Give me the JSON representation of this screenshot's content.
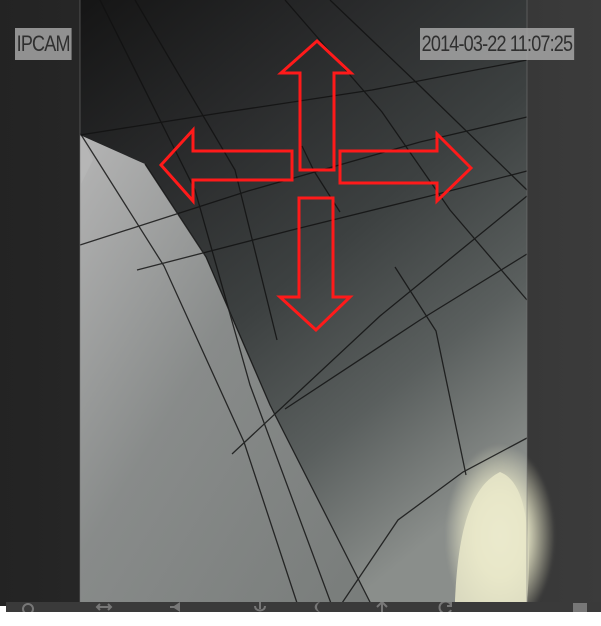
{
  "camera_view": {
    "camera_name": "IPCAM",
    "timestamp": "2014-03-22 11:07:25"
  },
  "ptz_controls": {
    "arrows": [
      {
        "direction": "up",
        "icon": "arrow-up-icon"
      },
      {
        "direction": "left",
        "icon": "arrow-left-icon"
      },
      {
        "direction": "right",
        "icon": "arrow-right-icon"
      },
      {
        "direction": "down",
        "icon": "arrow-down-icon"
      }
    ],
    "arrow_color": "#ff1a1a"
  },
  "toolbar": {
    "icons": [
      "power-icon",
      "mirror-icon",
      "speaker-icon",
      "microphone-icon",
      "night-mode-icon",
      "upload-icon",
      "refresh-icon",
      "screen-icon"
    ]
  },
  "colors": {
    "dark_panel": "#3a3a3a",
    "overlay_background": "#aaaaaa",
    "overlay_text": "#2f2f2f"
  }
}
